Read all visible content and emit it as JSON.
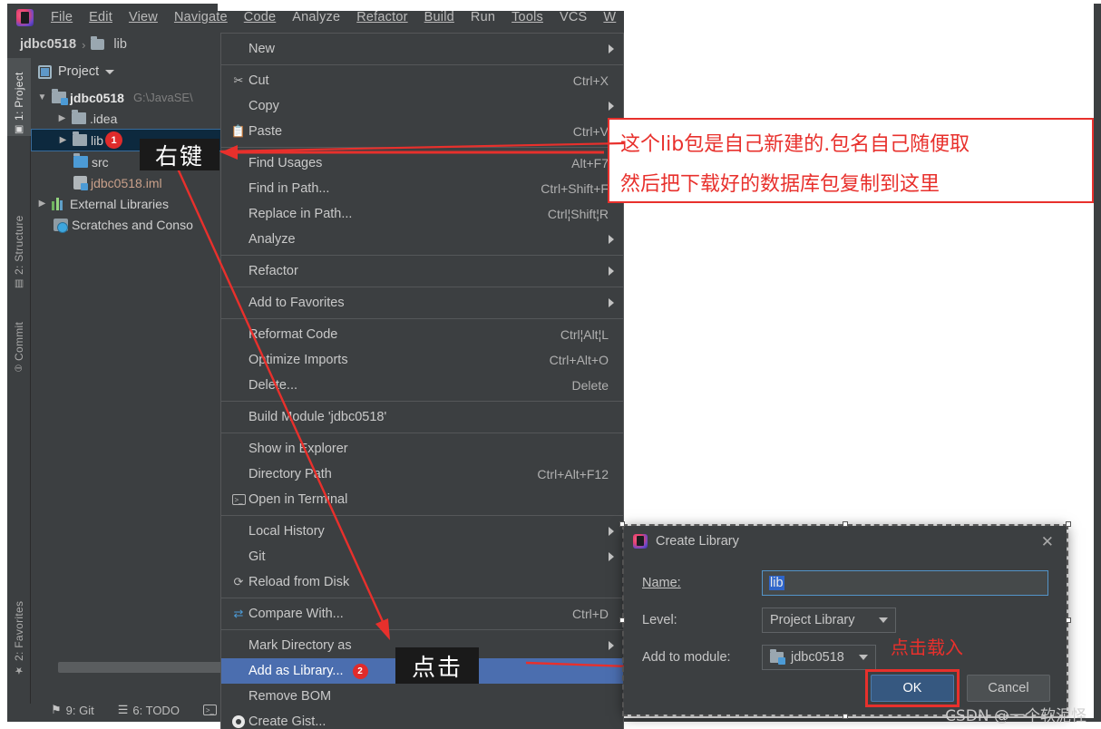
{
  "app": {
    "logo_icon": "intellij-idea-logo",
    "menubar": [
      {
        "label": "File",
        "accel": "F"
      },
      {
        "label": "Edit",
        "accel": "E"
      },
      {
        "label": "View",
        "accel": "V"
      },
      {
        "label": "Navigate",
        "accel": "N"
      },
      {
        "label": "Code",
        "accel": "C"
      },
      {
        "label": "Analyze",
        "accel": "z"
      },
      {
        "label": "Refactor",
        "accel": "R"
      },
      {
        "label": "Build",
        "accel": "B"
      },
      {
        "label": "Run",
        "accel": "u"
      },
      {
        "label": "Tools",
        "accel": "T"
      },
      {
        "label": "VCS",
        "accel": "S"
      },
      {
        "label": "W",
        "accel": "W"
      }
    ]
  },
  "navbar": {
    "project": "jdbc0518",
    "separator": "›",
    "folder_icon": "folder-icon",
    "current": "lib"
  },
  "toolstrip": {
    "tabs": [
      {
        "label": "1: Project",
        "icon": "project-icon",
        "active": true
      },
      {
        "label": "2: Structure",
        "icon": "structure-icon",
        "active": false
      },
      {
        "label": "Commit",
        "icon": "commit-icon",
        "active": false
      },
      {
        "label": "2: Favorites",
        "icon": "star-icon",
        "active": false
      }
    ]
  },
  "project_panel": {
    "title": "Project",
    "title_icon": "project-window-icon",
    "dropdown_icon": "chevron-down-icon",
    "tree": [
      {
        "label": "jdbc0518",
        "path": "G:\\JavaSE\\",
        "icon": "module-folder-icon",
        "arrow": "▼",
        "depth": 0,
        "bold": true,
        "selected": false,
        "badge": ""
      },
      {
        "label": ".idea",
        "path": "",
        "icon": "folder-icon",
        "arrow": "▶",
        "depth": 1,
        "bold": false,
        "selected": false,
        "badge": ""
      },
      {
        "label": "lib",
        "path": "",
        "icon": "folder-icon",
        "arrow": "▶",
        "depth": 1,
        "bold": false,
        "selected": true,
        "badge": "1"
      },
      {
        "label": "src",
        "path": "",
        "icon": "source-folder-icon",
        "arrow": "",
        "depth": 1,
        "bold": false,
        "selected": false,
        "badge": ""
      },
      {
        "label": "jdbc0518.iml",
        "path": "",
        "icon": "iml-file-icon",
        "arrow": "",
        "depth": 1,
        "bold": false,
        "selected": false,
        "badge": ""
      },
      {
        "label": "External Libraries",
        "path": "",
        "icon": "external-libraries-icon",
        "arrow": "▶",
        "depth": 0,
        "bold": false,
        "selected": false,
        "badge": ""
      },
      {
        "label": "Scratches and Conso",
        "path": "",
        "icon": "scratches-icon",
        "arrow": "",
        "depth": 0,
        "bold": false,
        "selected": false,
        "badge": ""
      }
    ]
  },
  "context_menu": {
    "items": [
      {
        "label": "New",
        "key": "",
        "icon": "",
        "arrow": true,
        "sep_after": true,
        "highlight": false,
        "badge": ""
      },
      {
        "label": "Cut",
        "key": "Ctrl+X",
        "icon": "scissors-icon",
        "arrow": false,
        "sep_after": false,
        "highlight": false,
        "badge": ""
      },
      {
        "label": "Copy",
        "key": "",
        "icon": "",
        "arrow": true,
        "sep_after": false,
        "highlight": false,
        "badge": ""
      },
      {
        "label": "Paste",
        "key": "Ctrl+V",
        "icon": "clipboard-icon",
        "arrow": false,
        "sep_after": true,
        "highlight": false,
        "badge": ""
      },
      {
        "label": "Find Usages",
        "key": "Alt+F7",
        "icon": "",
        "arrow": false,
        "sep_after": false,
        "highlight": false,
        "badge": ""
      },
      {
        "label": "Find in Path...",
        "key": "Ctrl+Shift+F",
        "icon": "",
        "arrow": false,
        "sep_after": false,
        "highlight": false,
        "badge": ""
      },
      {
        "label": "Replace in Path...",
        "key": "Ctrl¦Shift¦R",
        "icon": "",
        "arrow": false,
        "sep_after": false,
        "highlight": false,
        "badge": ""
      },
      {
        "label": "Analyze",
        "key": "",
        "icon": "",
        "arrow": true,
        "sep_after": true,
        "highlight": false,
        "badge": ""
      },
      {
        "label": "Refactor",
        "key": "",
        "icon": "",
        "arrow": true,
        "sep_after": true,
        "highlight": false,
        "badge": ""
      },
      {
        "label": "Add to Favorites",
        "key": "",
        "icon": "",
        "arrow": true,
        "sep_after": true,
        "highlight": false,
        "badge": ""
      },
      {
        "label": "Reformat Code",
        "key": "Ctrl¦Alt¦L",
        "icon": "",
        "arrow": false,
        "sep_after": false,
        "highlight": false,
        "badge": ""
      },
      {
        "label": "Optimize Imports",
        "key": "Ctrl+Alt+O",
        "icon": "",
        "arrow": false,
        "sep_after": false,
        "highlight": false,
        "badge": ""
      },
      {
        "label": "Delete...",
        "key": "Delete",
        "icon": "",
        "arrow": false,
        "sep_after": true,
        "highlight": false,
        "badge": ""
      },
      {
        "label": "Build Module 'jdbc0518'",
        "key": "",
        "icon": "",
        "arrow": false,
        "sep_after": true,
        "highlight": false,
        "badge": ""
      },
      {
        "label": "Show in Explorer",
        "key": "",
        "icon": "",
        "arrow": false,
        "sep_after": false,
        "highlight": false,
        "badge": ""
      },
      {
        "label": "Directory Path",
        "key": "Ctrl+Alt+F12",
        "icon": "",
        "arrow": false,
        "sep_after": false,
        "highlight": false,
        "badge": ""
      },
      {
        "label": "Open in Terminal",
        "key": "",
        "icon": "terminal-icon",
        "arrow": false,
        "sep_after": true,
        "highlight": false,
        "badge": ""
      },
      {
        "label": "Local History",
        "key": "",
        "icon": "",
        "arrow": true,
        "sep_after": false,
        "highlight": false,
        "badge": ""
      },
      {
        "label": "Git",
        "key": "",
        "icon": "",
        "arrow": true,
        "sep_after": false,
        "highlight": false,
        "badge": ""
      },
      {
        "label": "Reload from Disk",
        "key": "",
        "icon": "reload-icon",
        "arrow": false,
        "sep_after": true,
        "highlight": false,
        "badge": ""
      },
      {
        "label": "Compare With...",
        "key": "Ctrl+D",
        "icon": "compare-icon",
        "arrow": false,
        "sep_after": true,
        "highlight": false,
        "badge": ""
      },
      {
        "label": "Mark Directory as",
        "key": "",
        "icon": "",
        "arrow": true,
        "sep_after": false,
        "highlight": false,
        "badge": ""
      },
      {
        "label": "Add as Library...",
        "key": "",
        "icon": "",
        "arrow": false,
        "sep_after": false,
        "highlight": true,
        "badge": "2"
      },
      {
        "label": "Remove BOM",
        "key": "",
        "icon": "",
        "arrow": false,
        "sep_after": false,
        "highlight": false,
        "badge": ""
      },
      {
        "label": "Create Gist...",
        "key": "",
        "icon": "gist-icon",
        "arrow": false,
        "sep_after": false,
        "highlight": false,
        "badge": ""
      }
    ]
  },
  "annotations": {
    "callout_right_click": "右键",
    "callout_click": "点击",
    "red_note_lines": [
      "这个lib包是自己新建的.包名自己随便取",
      "然后把下载好的数据库包复制到这里"
    ],
    "dialog_note": "点击载入",
    "accent_red": "#E8302C"
  },
  "dialog": {
    "title": "Create Library",
    "title_icon": "intellij-idea-logo",
    "close_icon": "close-icon",
    "fields": [
      {
        "label": "Name:",
        "accel": "N",
        "type": "text",
        "value": "lib"
      },
      {
        "label": "Level:",
        "accel": "",
        "type": "select",
        "value": "Project Library"
      },
      {
        "label": "Add to module:",
        "accel": "",
        "type": "select-module",
        "value": "jdbc0518"
      }
    ],
    "ok_label": "OK",
    "cancel_label": "Cancel"
  },
  "statusbar": {
    "items": [
      {
        "label": "9: Git",
        "icon": "git-branch-icon"
      },
      {
        "label": "6: TODO",
        "icon": "todo-list-icon"
      },
      {
        "label": "",
        "icon": "terminal-icon"
      }
    ]
  },
  "watermark": "CSDN @一个软泥怪"
}
